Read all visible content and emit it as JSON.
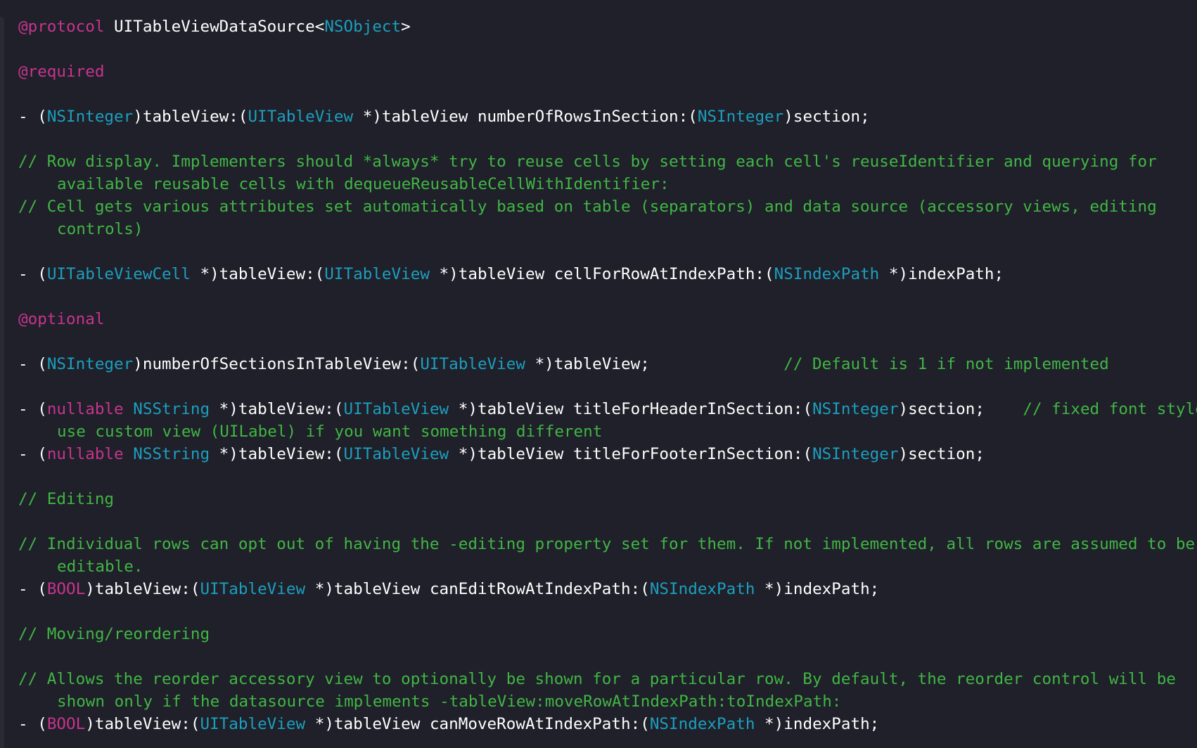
{
  "editor": {
    "theme_colors": {
      "background": "#1f2029",
      "keyword": "#c8348f",
      "type": "#1c9fbf",
      "plain": "#ffffff",
      "comment": "#41b645"
    },
    "lines": [
      {
        "tokens": [
          {
            "t": "kw",
            "v": "@protocol"
          },
          {
            "t": "pl",
            "v": " UITableViewDataSource<"
          },
          {
            "t": "ty",
            "v": "NSObject"
          },
          {
            "t": "pl",
            "v": ">"
          }
        ]
      },
      {
        "tokens": []
      },
      {
        "tokens": [
          {
            "t": "kw",
            "v": "@required"
          }
        ]
      },
      {
        "tokens": []
      },
      {
        "tokens": [
          {
            "t": "pl",
            "v": "- ("
          },
          {
            "t": "ty",
            "v": "NSInteger"
          },
          {
            "t": "pl",
            "v": ")tableView:("
          },
          {
            "t": "ty",
            "v": "UITableView"
          },
          {
            "t": "pl",
            "v": " *)tableView numberOfRowsInSection:("
          },
          {
            "t": "ty",
            "v": "NSInteger"
          },
          {
            "t": "pl",
            "v": ")section;"
          }
        ]
      },
      {
        "tokens": []
      },
      {
        "tokens": [
          {
            "t": "cm",
            "v": "// Row display. Implementers should *always* try to reuse cells by setting each cell's reuseIdentifier and querying for"
          }
        ]
      },
      {
        "wrap": true,
        "tokens": [
          {
            "t": "cm",
            "v": "available reusable cells with dequeueReusableCellWithIdentifier:"
          }
        ]
      },
      {
        "tokens": [
          {
            "t": "cm",
            "v": "// Cell gets various attributes set automatically based on table (separators) and data source (accessory views, editing"
          }
        ]
      },
      {
        "wrap": true,
        "tokens": [
          {
            "t": "cm",
            "v": "controls)"
          }
        ]
      },
      {
        "tokens": []
      },
      {
        "tokens": [
          {
            "t": "pl",
            "v": "- ("
          },
          {
            "t": "ty",
            "v": "UITableViewCell"
          },
          {
            "t": "pl",
            "v": " *)tableView:("
          },
          {
            "t": "ty",
            "v": "UITableView"
          },
          {
            "t": "pl",
            "v": " *)tableView cellForRowAtIndexPath:("
          },
          {
            "t": "ty",
            "v": "NSIndexPath"
          },
          {
            "t": "pl",
            "v": " *)indexPath;"
          }
        ]
      },
      {
        "tokens": []
      },
      {
        "tokens": [
          {
            "t": "kw",
            "v": "@optional"
          }
        ]
      },
      {
        "tokens": []
      },
      {
        "tokens": [
          {
            "t": "pl",
            "v": "- ("
          },
          {
            "t": "ty",
            "v": "NSInteger"
          },
          {
            "t": "pl",
            "v": ")numberOfSectionsInTableView:("
          },
          {
            "t": "ty",
            "v": "UITableView"
          },
          {
            "t": "pl",
            "v": " *)tableView;              "
          },
          {
            "t": "cm",
            "v": "// Default is 1 if not implemented"
          }
        ]
      },
      {
        "tokens": []
      },
      {
        "tokens": [
          {
            "t": "pl",
            "v": "- ("
          },
          {
            "t": "kw",
            "v": "nullable"
          },
          {
            "t": "pl",
            "v": " "
          },
          {
            "t": "ty",
            "v": "NSString"
          },
          {
            "t": "pl",
            "v": " *)tableView:("
          },
          {
            "t": "ty",
            "v": "UITableView"
          },
          {
            "t": "pl",
            "v": " *)tableView titleForHeaderInSection:("
          },
          {
            "t": "ty",
            "v": "NSInteger"
          },
          {
            "t": "pl",
            "v": ")section;    "
          },
          {
            "t": "cm",
            "v": "// fixed font style."
          }
        ]
      },
      {
        "wrap": true,
        "tokens": [
          {
            "t": "cm",
            "v": "use custom view (UILabel) if you want something different"
          }
        ]
      },
      {
        "tokens": [
          {
            "t": "pl",
            "v": "- ("
          },
          {
            "t": "kw",
            "v": "nullable"
          },
          {
            "t": "pl",
            "v": " "
          },
          {
            "t": "ty",
            "v": "NSString"
          },
          {
            "t": "pl",
            "v": " *)tableView:("
          },
          {
            "t": "ty",
            "v": "UITableView"
          },
          {
            "t": "pl",
            "v": " *)tableView titleForFooterInSection:("
          },
          {
            "t": "ty",
            "v": "NSInteger"
          },
          {
            "t": "pl",
            "v": ")section;"
          }
        ]
      },
      {
        "tokens": []
      },
      {
        "tokens": [
          {
            "t": "cm",
            "v": "// Editing"
          }
        ]
      },
      {
        "tokens": []
      },
      {
        "tokens": [
          {
            "t": "cm",
            "v": "// Individual rows can opt out of having the -editing property set for them. If not implemented, all rows are assumed to be"
          }
        ]
      },
      {
        "wrap": true,
        "tokens": [
          {
            "t": "cm",
            "v": "editable."
          }
        ]
      },
      {
        "tokens": [
          {
            "t": "pl",
            "v": "- ("
          },
          {
            "t": "kw",
            "v": "BOOL"
          },
          {
            "t": "pl",
            "v": ")tableView:("
          },
          {
            "t": "ty",
            "v": "UITableView"
          },
          {
            "t": "pl",
            "v": " *)tableView canEditRowAtIndexPath:("
          },
          {
            "t": "ty",
            "v": "NSIndexPath"
          },
          {
            "t": "pl",
            "v": " *)indexPath;"
          }
        ]
      },
      {
        "tokens": []
      },
      {
        "tokens": [
          {
            "t": "cm",
            "v": "// Moving/reordering"
          }
        ]
      },
      {
        "tokens": []
      },
      {
        "tokens": [
          {
            "t": "cm",
            "v": "// Allows the reorder accessory view to optionally be shown for a particular row. By default, the reorder control will be"
          }
        ]
      },
      {
        "wrap": true,
        "tokens": [
          {
            "t": "cm",
            "v": "shown only if the datasource implements -tableView:moveRowAtIndexPath:toIndexPath:"
          }
        ]
      },
      {
        "tokens": [
          {
            "t": "pl",
            "v": "- ("
          },
          {
            "t": "kw",
            "v": "BOOL"
          },
          {
            "t": "pl",
            "v": ")tableView:("
          },
          {
            "t": "ty",
            "v": "UITableView"
          },
          {
            "t": "pl",
            "v": " *)tableView canMoveRowAtIndexPath:("
          },
          {
            "t": "ty",
            "v": "NSIndexPath"
          },
          {
            "t": "pl",
            "v": " *)indexPath;"
          }
        ]
      }
    ]
  }
}
